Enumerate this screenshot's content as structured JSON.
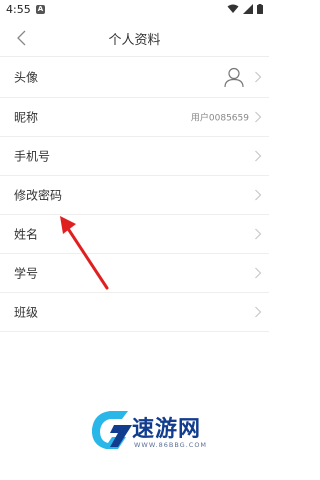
{
  "status_bar": {
    "time": "4:55",
    "notification_badge": "A"
  },
  "header": {
    "title": "个人资料"
  },
  "profile_items": [
    {
      "label": "头像",
      "value": ""
    },
    {
      "label": "昵称",
      "value": "用户0085659"
    },
    {
      "label": "手机号",
      "value": ""
    },
    {
      "label": "修改密码",
      "value": ""
    },
    {
      "label": "姓名",
      "value": ""
    },
    {
      "label": "学号",
      "value": ""
    },
    {
      "label": "班级",
      "value": ""
    }
  ],
  "watermark": {
    "brand": "速游网",
    "url": "WWW.86BBG.COM"
  },
  "colors": {
    "annotation": "#e02020",
    "watermark_blue": "#123d8f",
    "watermark_cyan": "#29b6e8"
  }
}
